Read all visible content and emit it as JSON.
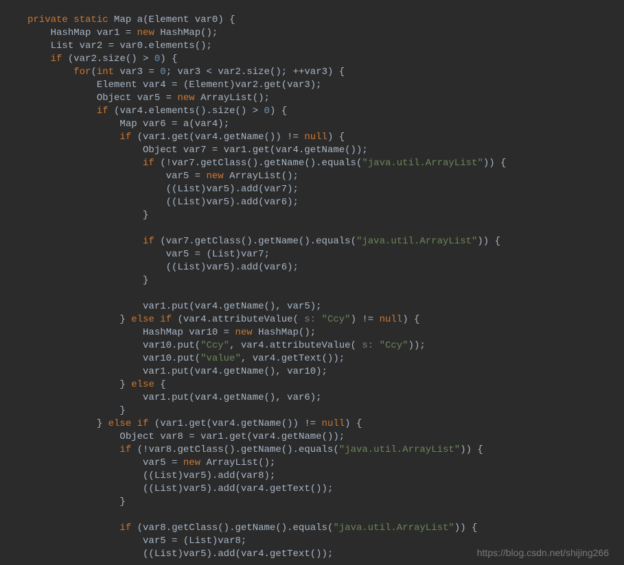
{
  "watermark": "https://blog.csdn.net/shijing266",
  "code": {
    "tokens": {
      "kw_private": "private",
      "kw_static": "static",
      "kw_new": "new",
      "kw_if": "if",
      "kw_for": "for",
      "kw_int": "int",
      "kw_else": "else",
      "kw_null": "null",
      "num_0": "0",
      "str_arraylist": "\"java.util.ArrayList\"",
      "str_ccy": "\"Ccy\"",
      "str_value": "\"value\"",
      "hint_s": "s:"
    },
    "identifiers": {
      "Map": "Map",
      "a": "a",
      "Element": "Element",
      "var0": "var0",
      "HashMap": "HashMap",
      "var1": "var1",
      "List": "List",
      "var2": "var2",
      "elements": "elements",
      "size": "size",
      "var3": "var3",
      "var4": "var4",
      "get": "get",
      "Object": "Object",
      "var5": "var5",
      "ArrayList": "ArrayList",
      "var6": "var6",
      "getName": "getName",
      "var7": "var7",
      "getClass": "getClass",
      "equals": "equals",
      "add": "add",
      "put": "put",
      "attributeValue": "attributeValue",
      "var10": "var10",
      "getText": "getText",
      "var8": "var8"
    }
  }
}
